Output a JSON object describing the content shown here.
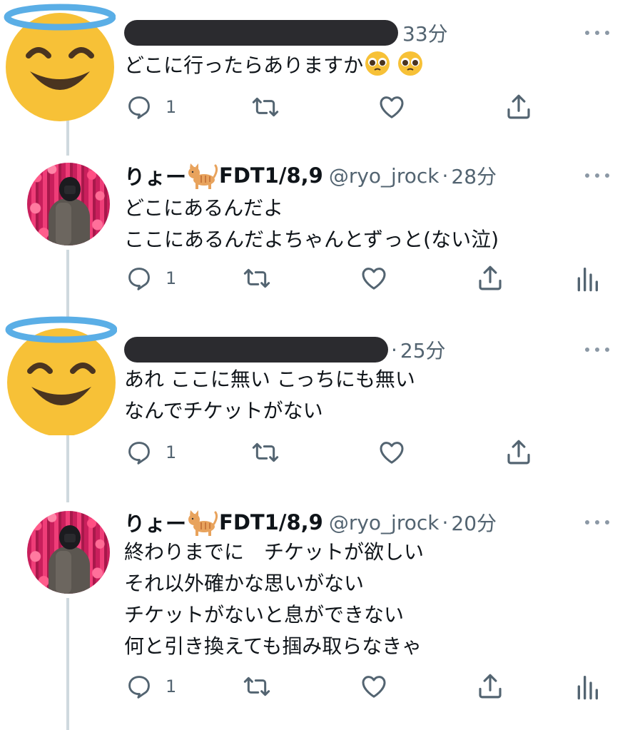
{
  "tweets": [
    {
      "author_redacted": true,
      "time": "33分",
      "time_prefix": "",
      "text": "どこに行ったらありますか",
      "emoji_after_text": [
        "pleading-face",
        "pleading-face"
      ],
      "reply_count": "1",
      "avatar": "smiling-face-with-halo",
      "has_analytics": false
    },
    {
      "author_redacted": false,
      "name": "りょー",
      "name_suffix": "FDT1/8,9",
      "name_emoji": "cat",
      "handle": "@ryo_jrock",
      "time": "28分",
      "time_prefix": "·",
      "text": "どこにあるんだよ\nここにあるんだよちゃんとずっと(ない泣)",
      "reply_count": "1",
      "avatar": "profile-photo",
      "has_analytics": true
    },
    {
      "author_redacted": true,
      "time": "25分",
      "time_prefix": "·",
      "text": "あれ ここに無い こっちにも無い\nなんでチケットがない",
      "reply_count": "1",
      "avatar": "smiling-face-with-halo",
      "has_analytics": false
    },
    {
      "author_redacted": false,
      "name": "りょー",
      "name_suffix": "FDT1/8,9",
      "name_emoji": "cat",
      "handle": "@ryo_jrock",
      "time": "20分",
      "time_prefix": "·",
      "text": "終わりまでに　チケットが欲しい\nそれ以外確かな思いがない\nチケットがないと息ができない\n何と引き換えても掴み取らなきゃ",
      "reply_count": "1",
      "avatar": "profile-photo",
      "has_analytics": true
    }
  ],
  "icons": {
    "reply": "reply-icon",
    "retweet": "retweet-icon",
    "like": "heart-icon",
    "share": "share-icon",
    "analytics": "analytics-icon",
    "more": "more-icon"
  },
  "colors": {
    "text": "#0f1419",
    "secondary": "#536471",
    "icon": "#536471",
    "thread_line": "#cfd9de",
    "redaction": "#2b2b2f",
    "emoji_yellow": "#f7c137",
    "halo_blue": "#5aaee6"
  }
}
